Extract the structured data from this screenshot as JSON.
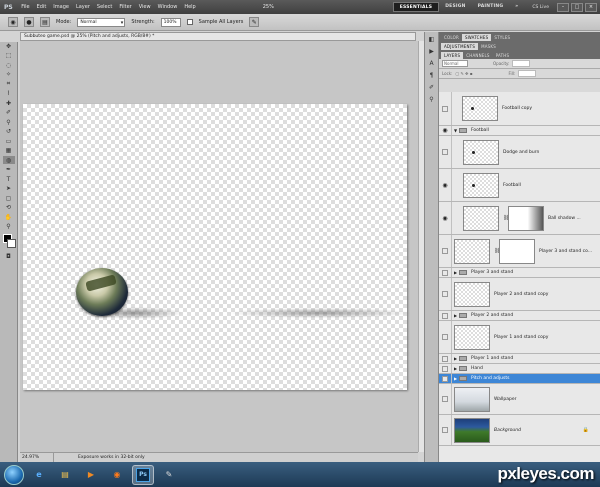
{
  "app": {
    "logo": "PS"
  },
  "menu": [
    "File",
    "Edit",
    "Image",
    "Layer",
    "Select",
    "Filter",
    "View",
    "Window",
    "Help"
  ],
  "zoom_box": "25%",
  "workspaces": {
    "essentials": "ESSENTIALS",
    "design": "DESIGN",
    "painting": "PAINTING",
    "more": "»",
    "cs_live": "CS Live"
  },
  "options": {
    "mode_label": "Mode:",
    "mode_value": "Normal",
    "strength_label": "Strength:",
    "strength_value": "100%",
    "sample_all": "Sample All Layers"
  },
  "document": {
    "tab_title": "Subbuteo game.psd @ 25% (Pitch and adjusts, RGB/8#) *"
  },
  "status": {
    "zoom": "24.97%",
    "info": "Exposure works in 32-bit only"
  },
  "panel_tabs": {
    "row1": [
      "COLOR",
      "SWATCHES",
      "STYLES"
    ],
    "row2": [
      "ADJUSTMENTS",
      "MASKS"
    ],
    "row3": [
      "LAYERS",
      "CHANNELS",
      "PATHS"
    ]
  },
  "layers_ctrl": {
    "blend": "Normal",
    "opacity_label": "Opacity:",
    "lock_label": "Lock:",
    "fill_label": "Fill:"
  },
  "layers": [
    {
      "name": "Football copy",
      "kind": "layer",
      "visible": false
    },
    {
      "name": "Football",
      "kind": "group",
      "visible": true,
      "open": true
    },
    {
      "name": "Dodge and burn",
      "kind": "layer",
      "visible": false
    },
    {
      "name": "Football",
      "kind": "layer",
      "visible": true
    },
    {
      "name": "Ball shadow ...",
      "kind": "masked",
      "visible": true
    },
    {
      "name": "Player 3 and stand co...",
      "kind": "masked",
      "visible": false
    },
    {
      "name": "Player 3 and stand",
      "kind": "group",
      "visible": false
    },
    {
      "name": "Player 2 and stand copy",
      "kind": "layer",
      "visible": false
    },
    {
      "name": "Player 2 and stand",
      "kind": "group",
      "visible": false
    },
    {
      "name": "Player 1 and stand copy",
      "kind": "layer",
      "visible": false
    },
    {
      "name": "Player 1 and stand",
      "kind": "group",
      "visible": false
    },
    {
      "name": "Hand",
      "kind": "group",
      "visible": false
    },
    {
      "name": "Pitch and adjusts",
      "kind": "group",
      "visible": false,
      "selected": true
    },
    {
      "name": "Wallpaper",
      "kind": "layer",
      "visible": false
    },
    {
      "name": "Background",
      "kind": "layer",
      "visible": false,
      "locked": true
    }
  ],
  "taskbar": {
    "ps_label": "Ps"
  },
  "watermark": "pxleyes.com",
  "colors": {
    "menubar": "#4a4a4a",
    "selection": "#3d86d6",
    "taskbar": "#2a4a68"
  }
}
